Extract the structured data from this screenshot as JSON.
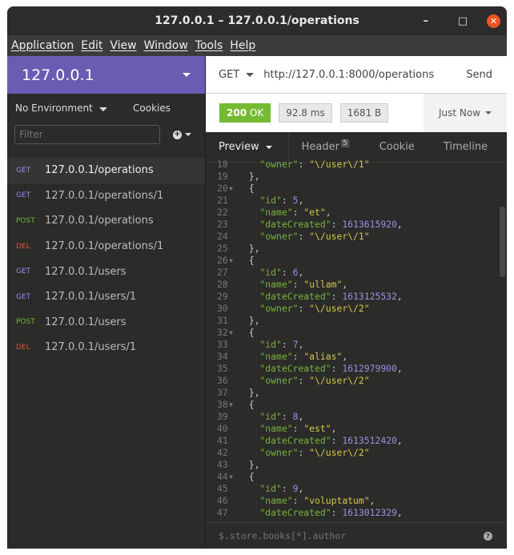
{
  "window": {
    "title": "127.0.0.1 – 127.0.0.1/operations"
  },
  "menu": [
    "Application",
    "Edit",
    "View",
    "Window",
    "Tools",
    "Help"
  ],
  "sidebar": {
    "workspace": "127.0.0.1",
    "environment": "No Environment",
    "cookies": "Cookies",
    "filter_placeholder": "Filter",
    "requests": [
      {
        "method": "GET",
        "url": "127.0.0.1/operations",
        "active": true
      },
      {
        "method": "GET",
        "url": "127.0.0.1/operations/1"
      },
      {
        "method": "POST",
        "url": "127.0.0.1/operations"
      },
      {
        "method": "DEL",
        "url": "127.0.0.1/operations/1"
      },
      {
        "method": "GET",
        "url": "127.0.0.1/users"
      },
      {
        "method": "GET",
        "url": "127.0.0.1/users/1"
      },
      {
        "method": "POST",
        "url": "127.0.0.1/users"
      },
      {
        "method": "DEL",
        "url": "127.0.0.1/users/1"
      }
    ]
  },
  "method_colors": {
    "GET": "#9a8cf0",
    "POST": "#75ba33",
    "DEL": "#e5533a"
  },
  "request": {
    "method": "GET",
    "url": "http://127.0.0.1:8000/operations",
    "send": "Send"
  },
  "response": {
    "status_code": "200",
    "status_text": "OK",
    "time": "92.8 ms",
    "size": "1681 B",
    "history": "Just Now"
  },
  "tabs": {
    "preview": "Preview",
    "header": "Header",
    "header_count": "5",
    "cookie": "Cookie",
    "timeline": "Timeline"
  },
  "code_lines": [
    {
      "n": 18,
      "i": 4,
      "k": "owner",
      "v": "\"\\/user\\/1\"",
      "t": "s"
    },
    {
      "n": 19,
      "i": 2,
      "p": "},"
    },
    {
      "n": 20,
      "i": 2,
      "p": "{",
      "fold": true
    },
    {
      "n": 21,
      "i": 4,
      "k": "id",
      "v": "5",
      "t": "n",
      "c": true
    },
    {
      "n": 22,
      "i": 4,
      "k": "name",
      "v": "\"et\"",
      "t": "s",
      "c": true
    },
    {
      "n": 23,
      "i": 4,
      "k": "dateCreated",
      "v": "1613615920",
      "t": "n",
      "c": true
    },
    {
      "n": 24,
      "i": 4,
      "k": "owner",
      "v": "\"\\/user\\/1\"",
      "t": "s"
    },
    {
      "n": 25,
      "i": 2,
      "p": "},"
    },
    {
      "n": 26,
      "i": 2,
      "p": "{",
      "fold": true
    },
    {
      "n": 27,
      "i": 4,
      "k": "id",
      "v": "6",
      "t": "n",
      "c": true
    },
    {
      "n": 28,
      "i": 4,
      "k": "name",
      "v": "\"ullam\"",
      "t": "s",
      "c": true
    },
    {
      "n": 29,
      "i": 4,
      "k": "dateCreated",
      "v": "1613125532",
      "t": "n",
      "c": true
    },
    {
      "n": 30,
      "i": 4,
      "k": "owner",
      "v": "\"\\/user\\/2\"",
      "t": "s"
    },
    {
      "n": 31,
      "i": 2,
      "p": "},"
    },
    {
      "n": 32,
      "i": 2,
      "p": "{",
      "fold": true
    },
    {
      "n": 33,
      "i": 4,
      "k": "id",
      "v": "7",
      "t": "n",
      "c": true
    },
    {
      "n": 34,
      "i": 4,
      "k": "name",
      "v": "\"alias\"",
      "t": "s",
      "c": true
    },
    {
      "n": 35,
      "i": 4,
      "k": "dateCreated",
      "v": "1612979900",
      "t": "n",
      "c": true
    },
    {
      "n": 36,
      "i": 4,
      "k": "owner",
      "v": "\"\\/user\\/2\"",
      "t": "s"
    },
    {
      "n": 37,
      "i": 2,
      "p": "},"
    },
    {
      "n": 38,
      "i": 2,
      "p": "{",
      "fold": true
    },
    {
      "n": 39,
      "i": 4,
      "k": "id",
      "v": "8",
      "t": "n",
      "c": true
    },
    {
      "n": 40,
      "i": 4,
      "k": "name",
      "v": "\"est\"",
      "t": "s",
      "c": true
    },
    {
      "n": 41,
      "i": 4,
      "k": "dateCreated",
      "v": "1613512420",
      "t": "n",
      "c": true
    },
    {
      "n": 42,
      "i": 4,
      "k": "owner",
      "v": "\"\\/user\\/2\"",
      "t": "s"
    },
    {
      "n": 43,
      "i": 2,
      "p": "},"
    },
    {
      "n": 44,
      "i": 2,
      "p": "{",
      "fold": true
    },
    {
      "n": 45,
      "i": 4,
      "k": "id",
      "v": "9",
      "t": "n",
      "c": true
    },
    {
      "n": 46,
      "i": 4,
      "k": "name",
      "v": "\"voluptatum\"",
      "t": "s",
      "c": true
    },
    {
      "n": 47,
      "i": 4,
      "k": "dateCreated",
      "v": "1613012329",
      "t": "n",
      "c": true
    }
  ],
  "query": {
    "placeholder": "$.store.books[*].author"
  }
}
